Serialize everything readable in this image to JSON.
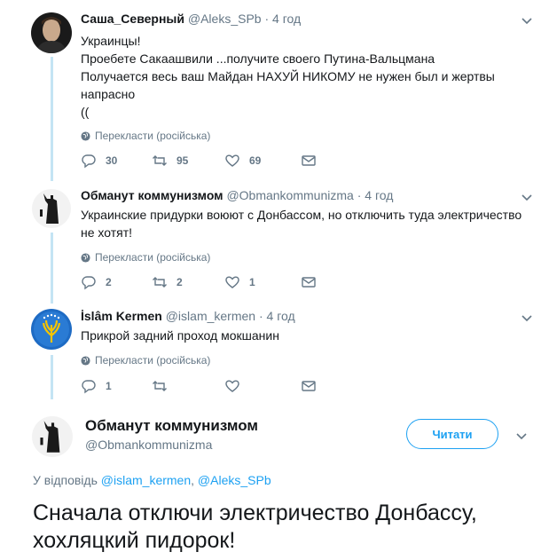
{
  "tweets": [
    {
      "name": "Саша_Северный",
      "handle": "@Aleks_SPb",
      "dot": "·",
      "time": "4 год",
      "lines": [
        "Украинцы!",
        "Проебете Сакаашвили ...получите своего Путина-Вальцмана",
        "Получается весь ваш Майдан НАХУЙ НИКОМУ не нужен был и жертвы",
        "напрасно",
        "(("
      ],
      "translate": "Перекласти (російська)",
      "replies": "30",
      "retweets": "95",
      "likes": "69"
    },
    {
      "name": "Обманут коммунизмом",
      "handle": "@Obmankommunizma",
      "dot": "·",
      "time": "4 год",
      "lines": [
        "Украинские придурки воюют с Донбассом, но отключить туда электричество",
        "не хотят!"
      ],
      "translate": "Перекласти (російська)",
      "replies": "2",
      "retweets": "2",
      "likes": "1"
    },
    {
      "name": "İslâm Kermen",
      "handle": "@islam_kermen",
      "dot": "·",
      "time": "4 год",
      "lines": [
        "Прикрой задний проход мокшанин"
      ],
      "translate": "Перекласти (російська)",
      "replies": "1",
      "retweets": "",
      "likes": ""
    }
  ],
  "main": {
    "name": "Обманут коммунизмом",
    "handle": "@Obmankommunizma",
    "follow_label": "Читати",
    "reply_prefix": "У відповідь",
    "reply_user1": "@islam_kermen",
    "reply_sep": ",",
    "reply_user2": "@Aleks_SPb",
    "text_line1": "Сначала отключи электричество Донбассу,",
    "text_line2": "хохляцкий пидорок!"
  },
  "colors": {
    "accent": "#1da1f2",
    "muted": "#657786",
    "thread": "#c4e4f4"
  },
  "icons": [
    "reply-icon",
    "retweet-icon",
    "like-icon",
    "dm-icon",
    "globe-icon",
    "chevron-down-icon"
  ]
}
